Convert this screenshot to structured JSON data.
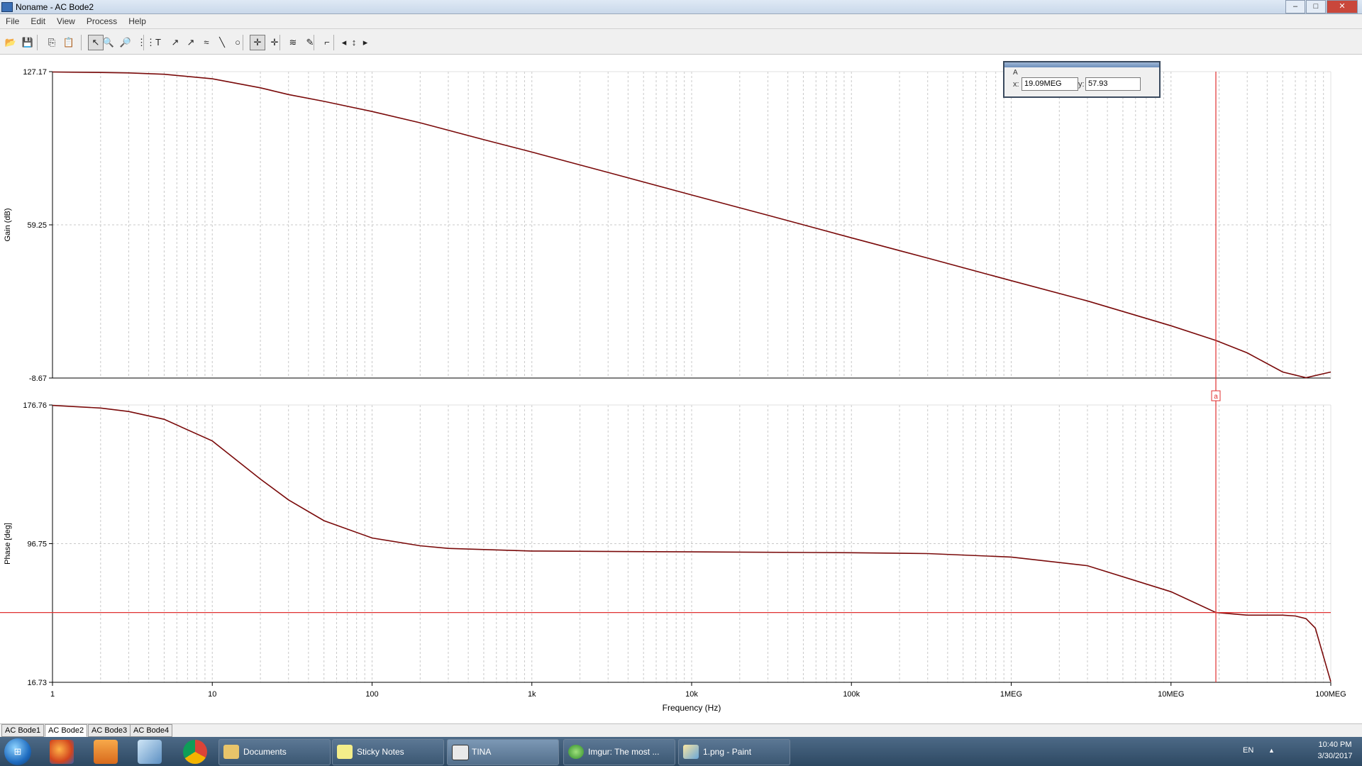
{
  "window": {
    "title": "Noname - AC Bode2",
    "min": "‒",
    "max": "□",
    "close": "✕"
  },
  "menu": [
    "File",
    "Edit",
    "View",
    "Process",
    "Help"
  ],
  "toolbar": {
    "icons": [
      "open-icon",
      "save-icon",
      "copy-icon",
      "paste-icon",
      "pointer-icon",
      "zoom-in-icon",
      "zoom-out-icon",
      "grid-icon",
      "text-icon",
      "label-icon",
      "label-arrow-icon",
      "axis-label-icon",
      "line-icon",
      "circle-icon",
      "cursor-a-icon",
      "cursor-b-icon",
      "curve-marker-icon",
      "probe-icon",
      "step-icon",
      "move-left-icon",
      "move-updown-icon",
      "move-right-icon"
    ],
    "glyphs": [
      "📂",
      "💾",
      "⎘",
      "📋",
      "↖",
      "🔍",
      "🔎",
      "⋮⋮",
      "T",
      "↗",
      "↗",
      "≈",
      "╲",
      "○",
      "✛",
      "✛",
      "≋",
      "✎",
      "⌐",
      "◂",
      "↕",
      "▸"
    ]
  },
  "cursor_box": {
    "header": "A",
    "x_label": "x:",
    "x_value": "19.09MEG",
    "y_label": "y:",
    "y_value": "57.93"
  },
  "chart_data": [
    {
      "type": "line",
      "ylabel": "Gain (dB)",
      "xlabel": "",
      "xscale": "log",
      "xlim": [
        1,
        100000000
      ],
      "ylim": [
        -8.67,
        127.17
      ],
      "yticks": [
        "127.17",
        "59.25",
        "-8.67"
      ],
      "grid": true,
      "color": "#7a0a0a",
      "series": [
        {
          "x": [
            1,
            2,
            3,
            5,
            10,
            20,
            30,
            50,
            100,
            200,
            500,
            1000,
            3000,
            10000,
            30000,
            100000,
            300000,
            1000000,
            3000000,
            10000000,
            19090000,
            30000000,
            50000000,
            70000000,
            100000000
          ],
          "y": [
            127.0,
            126.8,
            126.6,
            126.0,
            124.0,
            120.0,
            117.0,
            114.0,
            109.5,
            104.5,
            97.0,
            91.5,
            82.5,
            72.5,
            63.5,
            53.5,
            44.5,
            34.5,
            25.5,
            14.5,
            8.0,
            2.5,
            -6.0,
            -8.5,
            -6.0
          ]
        }
      ]
    },
    {
      "type": "line",
      "ylabel": "Phase [deg]",
      "xlabel": "Frequency (Hz)",
      "xscale": "log",
      "xlim": [
        1,
        100000000
      ],
      "ylim": [
        16.73,
        176.76
      ],
      "yticks": [
        "176.76",
        "96.75",
        "16.73"
      ],
      "xticks": [
        "1",
        "10",
        "100",
        "1k",
        "10k",
        "100k",
        "1MEG",
        "10MEG",
        "100MEG"
      ],
      "grid": true,
      "color": "#7a0a0a",
      "series": [
        {
          "x": [
            1,
            2,
            3,
            5,
            10,
            20,
            30,
            50,
            100,
            200,
            300,
            1000,
            10000,
            100000,
            300000,
            1000000,
            3000000,
            10000000,
            19090000,
            30000000,
            50000000,
            60000000,
            70000000,
            80000000,
            100000000
          ],
          "y": [
            176.5,
            175.0,
            173.0,
            168.5,
            156.0,
            134.0,
            122.0,
            110.0,
            100.0,
            95.5,
            94.0,
            92.5,
            92.0,
            91.5,
            91.0,
            89.0,
            84.0,
            69.0,
            57.0,
            55.5,
            55.5,
            55.0,
            53.5,
            48.0,
            17.0
          ]
        }
      ]
    }
  ],
  "cursor": {
    "label": "a",
    "x": 19090000,
    "phase_y": 57.0
  },
  "tabs": [
    "AC Bode1",
    "AC Bode2",
    "AC Bode3",
    "AC Bode4"
  ],
  "active_tab": 1,
  "taskbar": {
    "tasks": [
      {
        "label": "Documents"
      },
      {
        "label": "Sticky Notes"
      },
      {
        "label": "TINA"
      },
      {
        "label": "Imgur: The most ..."
      },
      {
        "label": "1.png - Paint"
      }
    ],
    "lang": "EN",
    "time": "10:40 PM",
    "date": "3/30/2017"
  }
}
